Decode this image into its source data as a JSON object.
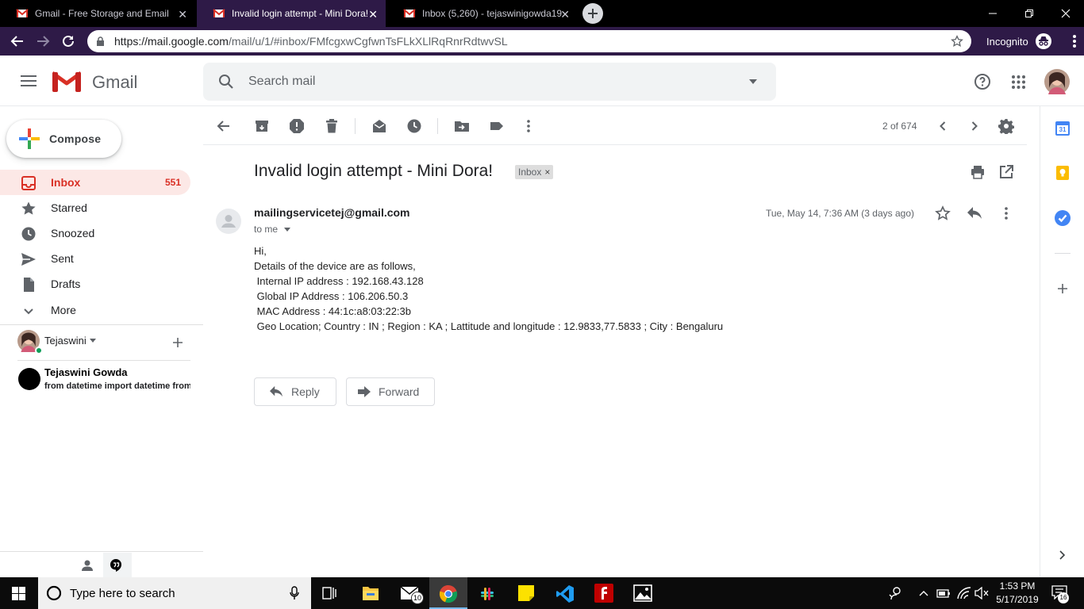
{
  "browser": {
    "tabs": [
      {
        "title": "Gmail - Free Storage and Email from Google"
      },
      {
        "title": "Invalid login attempt - Mini Dora! - tejaswinigowda"
      },
      {
        "title": "Inbox (5,260) - tejaswinigowda19"
      }
    ],
    "url": {
      "host": "https://mail.google.com",
      "path": "/mail/u/1/#inbox/FMfcgxwCgfwnTsFLkXLlRqRnrRdtwvSL"
    },
    "incognito_label": "Incognito"
  },
  "gmail": {
    "logo_text": "Gmail",
    "search_placeholder": "Search mail",
    "compose_label": "Compose",
    "nav": [
      {
        "label": "Inbox",
        "count": "551",
        "icon": "inbox-icon"
      },
      {
        "label": "Starred",
        "icon": "star-icon"
      },
      {
        "label": "Snoozed",
        "icon": "clock-icon"
      },
      {
        "label": "Sent",
        "icon": "send-icon"
      },
      {
        "label": "Drafts",
        "icon": "draft-icon"
      },
      {
        "label": "More",
        "icon": "chevron-down-icon"
      }
    ],
    "hangouts": {
      "user": "Tejaswini",
      "contact_name": "Tejaswini Gowda",
      "contact_snippet": "from datetime import datetime from"
    },
    "toolbar": {
      "pager": "2 of 674"
    },
    "message": {
      "subject": "Invalid login attempt - Mini Dora!",
      "label_chip": "Inbox",
      "sender": "mailingservicetej@gmail.com",
      "to": "to me",
      "date": "Tue, May 14, 7:36 AM (3 days ago)",
      "body": [
        "Hi,",
        "Details of the device are as follows,",
        " Internal IP address : 192.168.43.128",
        " Global IP Address : 106.206.50.3",
        " MAC Address : 44:1c:a8:03:22:3b",
        " Geo Location; Country : IN ; Region : KA ; Lattitude and longitude : 12.9833,77.5833 ; City : Bengaluru"
      ],
      "reply_label": "Reply",
      "forward_label": "Forward"
    },
    "side_apps": {
      "calendar_day": "31"
    }
  },
  "taskbar": {
    "search_placeholder": "Type here to search",
    "mail_badge": "10",
    "time": "1:53 PM",
    "date": "5/17/2019",
    "notification_count": "16"
  },
  "colors": {
    "chrome_incognito": "#2e1a47",
    "gmail_red": "#d93025",
    "taskbar": "#0b0b0b"
  }
}
